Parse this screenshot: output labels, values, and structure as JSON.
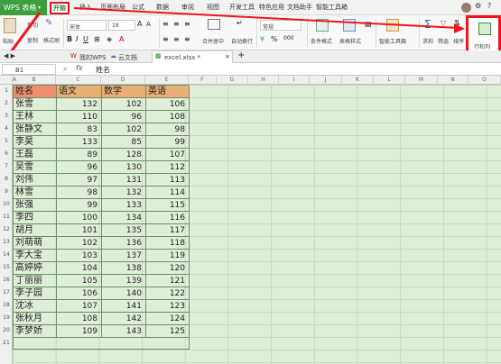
{
  "menubar": {
    "app_label": "WPS 表格",
    "tabs": [
      "开始",
      "插入",
      "页面布局",
      "公式",
      "数据",
      "审阅",
      "视图",
      "开发工具",
      "特色应用",
      "文档助手",
      "智能工具箱"
    ]
  },
  "ribbon": {
    "paste": "粘贴",
    "cut": "剪切",
    "copy": "复制",
    "format_painter": "格式刷",
    "font_name": "宋体",
    "font_size": "18",
    "merge_center": "合并居中",
    "wrap_text": "自动换行",
    "number_format": "常规",
    "conditional_format": "条件格式",
    "table_style": "表格样式",
    "smart_toolbox": "智能工具箱",
    "sum": "求和",
    "filter": "筛选",
    "sort": "排序",
    "format": "格式",
    "row_col": "行和列"
  },
  "tabbar": {
    "tabs": [
      "我的WPS",
      "云文档",
      "excel.xlsx *"
    ],
    "add_label": "+"
  },
  "formula_bar": {
    "cell_ref": "B1",
    "fx": "fx",
    "value": "姓名"
  },
  "columns": [
    "A",
    "B",
    "C",
    "D",
    "E",
    "F",
    "G",
    "H",
    "I",
    "J",
    "K",
    "L",
    "M",
    "N",
    "O"
  ],
  "rows": [
    "1",
    "2",
    "3",
    "4",
    "5",
    "6",
    "7",
    "8",
    "9",
    "10",
    "11",
    "12",
    "13",
    "14",
    "15",
    "16",
    "17",
    "18",
    "19",
    "20",
    "21"
  ],
  "table": {
    "headers": [
      "姓名",
      "语文",
      "数学",
      "英语"
    ],
    "rows": [
      [
        "张雪",
        "132",
        "102",
        "106"
      ],
      [
        "王林",
        "110",
        "96",
        "108"
      ],
      [
        "张静文",
        "83",
        "102",
        "98"
      ],
      [
        "李昊",
        "133",
        "85",
        "99"
      ],
      [
        "王磊",
        "89",
        "128",
        "107"
      ],
      [
        "吴雪",
        "96",
        "130",
        "112"
      ],
      [
        "刘伟",
        "97",
        "131",
        "113"
      ],
      [
        "林雪",
        "98",
        "132",
        "114"
      ],
      [
        "张强",
        "99",
        "133",
        "115"
      ],
      [
        "李四",
        "100",
        "134",
        "116"
      ],
      [
        "胡月",
        "101",
        "135",
        "117"
      ],
      [
        "刘萌萌",
        "102",
        "136",
        "118"
      ],
      [
        "李大宝",
        "103",
        "137",
        "119"
      ],
      [
        "高婷婷",
        "104",
        "138",
        "120"
      ],
      [
        "丁丽丽",
        "105",
        "139",
        "121"
      ],
      [
        "李子园",
        "106",
        "140",
        "122"
      ],
      [
        "沈冰",
        "107",
        "141",
        "123"
      ],
      [
        "张秋月",
        "108",
        "142",
        "124"
      ],
      [
        "李梦娇",
        "109",
        "143",
        "125"
      ]
    ]
  },
  "colors": {
    "accent": "#3c9e3c",
    "highlight": "#f2141c",
    "header_fill": "#e8b073",
    "sheet_bg": "#dfeed8"
  }
}
